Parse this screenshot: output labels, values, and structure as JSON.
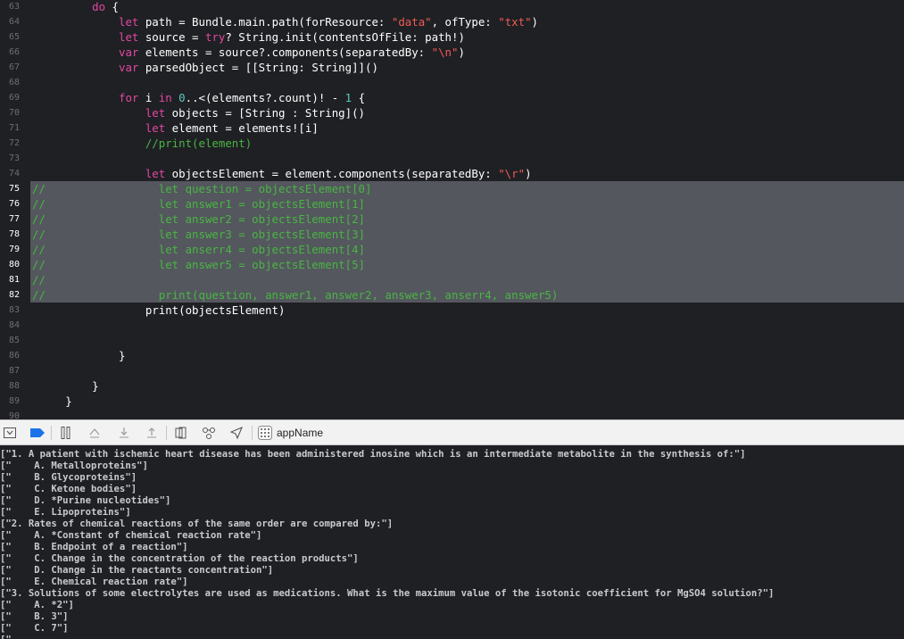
{
  "editor": {
    "lines": [
      {
        "n": "63",
        "sel": false,
        "tokens": [
          [
            "         ",
            ""
          ],
          [
            "do",
            "kw"
          ],
          [
            " {",
            ""
          ]
        ]
      },
      {
        "n": "64",
        "sel": false,
        "tokens": [
          [
            "             ",
            ""
          ],
          [
            "let",
            "kw"
          ],
          [
            " path = Bundle.main.path(forResource: ",
            ""
          ],
          [
            "\"data\"",
            "str"
          ],
          [
            ", ofType: ",
            ""
          ],
          [
            "\"txt\"",
            "str"
          ],
          [
            ")",
            ""
          ]
        ]
      },
      {
        "n": "65",
        "sel": false,
        "tokens": [
          [
            "             ",
            ""
          ],
          [
            "let",
            "kw"
          ],
          [
            " source = ",
            ""
          ],
          [
            "try",
            "kw"
          ],
          [
            "? String.init(contentsOfFile: path!)",
            ""
          ]
        ]
      },
      {
        "n": "66",
        "sel": false,
        "tokens": [
          [
            "             ",
            ""
          ],
          [
            "var",
            "kw"
          ],
          [
            " elements = source?.components(separatedBy: ",
            ""
          ],
          [
            "\"\\n\"",
            "str"
          ],
          [
            ")",
            ""
          ]
        ]
      },
      {
        "n": "67",
        "sel": false,
        "tokens": [
          [
            "             ",
            ""
          ],
          [
            "var",
            "kw"
          ],
          [
            " parsedObject = [[String: String]]()",
            ""
          ]
        ]
      },
      {
        "n": "68",
        "sel": false,
        "tokens": []
      },
      {
        "n": "69",
        "sel": false,
        "tokens": [
          [
            "             ",
            ""
          ],
          [
            "for",
            "kw"
          ],
          [
            " i ",
            ""
          ],
          [
            "in",
            "kw"
          ],
          [
            " ",
            ""
          ],
          [
            "0",
            "num"
          ],
          [
            "..<(elements?.count)! - ",
            ""
          ],
          [
            "1",
            "num"
          ],
          [
            " {",
            ""
          ]
        ]
      },
      {
        "n": "70",
        "sel": false,
        "tokens": [
          [
            "                 ",
            ""
          ],
          [
            "let",
            "kw"
          ],
          [
            " objects = [String : String]()",
            ""
          ]
        ]
      },
      {
        "n": "71",
        "sel": false,
        "tokens": [
          [
            "                 ",
            ""
          ],
          [
            "let",
            "kw"
          ],
          [
            " element = elements![i]",
            ""
          ]
        ]
      },
      {
        "n": "72",
        "sel": false,
        "tokens": [
          [
            "                 ",
            ""
          ],
          [
            "//print(element)",
            "cm"
          ]
        ]
      },
      {
        "n": "73",
        "sel": false,
        "tokens": []
      },
      {
        "n": "74",
        "sel": false,
        "tokens": [
          [
            "                 ",
            ""
          ],
          [
            "let",
            "kw"
          ],
          [
            " objectsElement = element.components(separatedBy: ",
            ""
          ],
          [
            "\"\\r\"",
            "str"
          ],
          [
            ")",
            ""
          ]
        ]
      },
      {
        "n": "75",
        "sel": true,
        "tokens": [
          [
            "//                 let question = objectsElement[0]",
            "cm"
          ]
        ]
      },
      {
        "n": "76",
        "sel": true,
        "tokens": [
          [
            "//                 let answer1 = objectsElement[1]",
            "cm"
          ]
        ]
      },
      {
        "n": "77",
        "sel": true,
        "tokens": [
          [
            "//                 let answer2 = objectsElement[2]",
            "cm"
          ]
        ]
      },
      {
        "n": "78",
        "sel": true,
        "tokens": [
          [
            "//                 let answer3 = objectsElement[3]",
            "cm"
          ]
        ]
      },
      {
        "n": "79",
        "sel": true,
        "tokens": [
          [
            "//                 let anserr4 = objectsElement[4]",
            "cm"
          ]
        ]
      },
      {
        "n": "80",
        "sel": true,
        "tokens": [
          [
            "//                 let answer5 = objectsElement[5]",
            "cm"
          ]
        ]
      },
      {
        "n": "81",
        "sel": true,
        "tokens": [
          [
            "//",
            "cm"
          ]
        ]
      },
      {
        "n": "82",
        "sel": true,
        "tokens": [
          [
            "//                 print(question, answer1, answer2, answer3, anserr4, answer5)",
            "cm"
          ]
        ]
      },
      {
        "n": "83",
        "sel": false,
        "tokens": [
          [
            "                 print(objectsElement)",
            ""
          ]
        ]
      },
      {
        "n": "84",
        "sel": false,
        "tokens": []
      },
      {
        "n": "85",
        "sel": false,
        "tokens": []
      },
      {
        "n": "86",
        "sel": false,
        "tokens": [
          [
            "             }",
            ""
          ]
        ]
      },
      {
        "n": "87",
        "sel": false,
        "tokens": []
      },
      {
        "n": "88",
        "sel": false,
        "tokens": [
          [
            "         }",
            ""
          ]
        ]
      },
      {
        "n": "89",
        "sel": false,
        "tokens": [
          [
            "     }",
            ""
          ]
        ]
      },
      {
        "n": "90",
        "sel": false,
        "tokens": []
      }
    ]
  },
  "debug_bar": {
    "app_name": "appName",
    "icons": [
      "hide-debug-area-icon",
      "breakpoints-toggle-icon",
      "pause-icon",
      "step-over-icon",
      "step-into-icon",
      "step-out-icon",
      "view-hierarchy-icon",
      "memory-graph-icon",
      "simulate-location-icon",
      "app-target-icon"
    ]
  },
  "console": {
    "lines": [
      "[\"1. A patient with ischemic heart disease has been administered inosine which is an intermediate metabolite in the synthesis of:\"]",
      "[\"    A. Metalloproteins\"]",
      "[\"    B. Glycoproteins\"]",
      "[\"    C. Ketone bodies\"]",
      "[\"    D. *Purine nucleotides\"]",
      "[\"    E. Lipoproteins\"]",
      "[\"2. Rates of chemical reactions of the same order are compared by:\"]",
      "[\"    A. *Constant of chemical reaction rate\"]",
      "[\"    B. Endpoint of a reaction\"]",
      "[\"    C. Change in the concentration of the reaction products\"]",
      "[\"    D. Change in the reactants concentration\"]",
      "[\"    E. Chemical reaction rate\"]",
      "[\"3. Solutions of some electrolytes are used as medications. What is the maximum value of the isotonic coefficient for MgSO4 solution?\"]",
      "[\"    A. *2\"]",
      "[\"    B. 3\"]",
      "[\"    C. 7\"]",
      "[\"    "
    ]
  }
}
